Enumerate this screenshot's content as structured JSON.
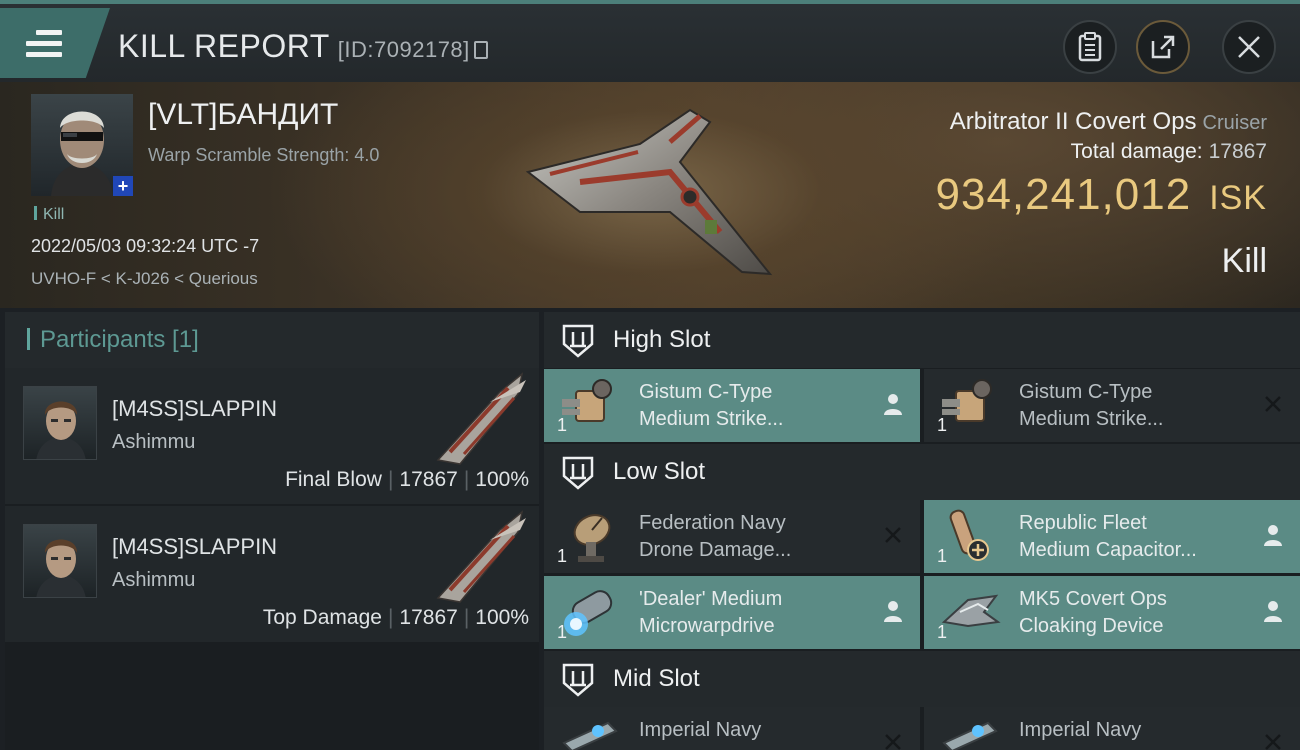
{
  "header": {
    "title": "KILL REPORT",
    "id_label": "[ID:7092178]"
  },
  "victim": {
    "name": "[VLT]БАНДИТ",
    "warp_scramble": "Warp Scramble Strength: 4.0",
    "tag": "Kill",
    "timestamp": "2022/05/03 09:32:24 UTC -7",
    "location": "UVHO-F < K-J026 < Querious",
    "ship_name": "Arbitrator II Covert Ops",
    "ship_class": "Cruiser",
    "total_damage_label": "Total damage:",
    "total_damage": "17867",
    "isk_value": "934,241,012",
    "isk_unit": "ISK",
    "result": "Kill"
  },
  "participants": {
    "header": "Participants [1]",
    "rows": [
      {
        "name": "[M4SS]SLAPPIN",
        "ship": "Ashimmu",
        "role": "Final Blow",
        "damage": "17867",
        "percent": "100%"
      },
      {
        "name": "[M4SS]SLAPPIN",
        "ship": "Ashimmu",
        "role": "Top Damage",
        "damage": "17867",
        "percent": "100%"
      }
    ]
  },
  "slots": {
    "high": {
      "label": "High Slot",
      "items": [
        {
          "line1": "Gistum C-Type",
          "line2": "Medium Strike...",
          "qty": "1",
          "status": "fitted"
        },
        {
          "line1": "Gistum C-Type",
          "line2": "Medium Strike...",
          "qty": "1",
          "status": "destroyed"
        }
      ]
    },
    "low": {
      "label": "Low Slot",
      "items": [
        {
          "line1": "Federation Navy",
          "line2": "Drone Damage...",
          "qty": "1",
          "status": "destroyed"
        },
        {
          "line1": "Republic Fleet",
          "line2": "Medium Capacitor...",
          "qty": "1",
          "status": "fitted"
        },
        {
          "line1": "'Dealer' Medium",
          "line2": "Microwarpdrive",
          "qty": "1",
          "status": "fitted"
        },
        {
          "line1": "MK5 Covert Ops",
          "line2": "Cloaking Device",
          "qty": "1",
          "status": "fitted"
        }
      ]
    },
    "mid": {
      "label": "Mid Slot",
      "items": [
        {
          "line1": "Imperial Navy",
          "line2": "",
          "qty": "",
          "status": "destroyed"
        },
        {
          "line1": "Imperial Navy",
          "line2": "",
          "qty": "",
          "status": "destroyed"
        }
      ]
    }
  },
  "icons": {
    "menu": "hamburger-icon",
    "clipboard": "clipboard-icon",
    "share": "share-icon",
    "close": "close-icon",
    "slot": "shield-icon",
    "fitted": "person-icon",
    "destroyed": "x-icon"
  },
  "colors": {
    "accent": "#5b8b85",
    "isk": "#e9c97f",
    "participants_header": "#5d9993"
  }
}
